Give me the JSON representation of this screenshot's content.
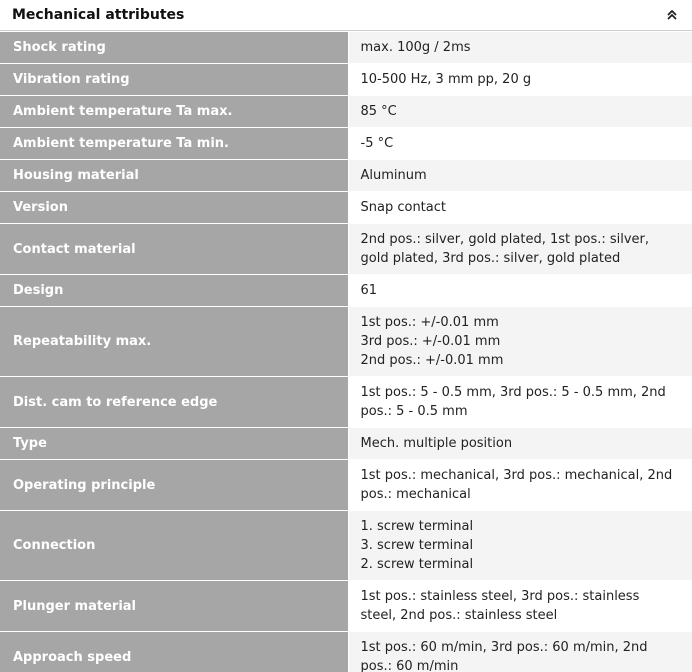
{
  "header": {
    "title": "Mechanical attributes"
  },
  "icons": {
    "collapse": "double-chevron-up-icon"
  },
  "rows": [
    {
      "label": "Shock rating",
      "lines": [
        "max. 100g / 2ms"
      ]
    },
    {
      "label": "Vibration rating",
      "lines": [
        "10-500 Hz, 3 mm pp, 20 g"
      ]
    },
    {
      "label": "Ambient temperature Ta max.",
      "lines": [
        "85 °C"
      ]
    },
    {
      "label": "Ambient temperature Ta min.",
      "lines": [
        "-5 °C"
      ]
    },
    {
      "label": "Housing material",
      "lines": [
        "Aluminum"
      ]
    },
    {
      "label": "Version",
      "lines": [
        "Snap contact"
      ]
    },
    {
      "label": "Contact material",
      "lines": [
        "2nd pos.: silver, gold plated, 1st pos.: silver,",
        "gold plated, 3rd pos.: silver, gold plated"
      ]
    },
    {
      "label": "Design",
      "lines": [
        "61"
      ]
    },
    {
      "label": "Repeatability max.",
      "lines": [
        "1st pos.: +/-0.01 mm",
        "3rd pos.: +/-0.01 mm",
        "2nd pos.: +/-0.01 mm"
      ]
    },
    {
      "label": "Dist. cam to reference edge",
      "lines": [
        "1st pos.: 5 - 0.5 mm, 3rd pos.: 5 - 0.5 mm, 2nd",
        "pos.: 5 - 0.5 mm"
      ]
    },
    {
      "label": "Type",
      "lines": [
        "Mech. multiple position"
      ]
    },
    {
      "label": "Operating principle",
      "lines": [
        "1st pos.: mechanical, 3rd pos.: mechanical, 2nd",
        "pos.: mechanical"
      ]
    },
    {
      "label": "Connection",
      "lines": [
        "1. screw terminal",
        "3. screw terminal",
        "2. screw terminal"
      ]
    },
    {
      "label": "Plunger material",
      "lines": [
        "1st pos.: stainless steel, 3rd pos.: stainless",
        "steel, 2nd pos.: stainless steel"
      ]
    },
    {
      "label": "Approach speed",
      "lines": [
        "1st pos.: 60 m/min, 3rd pos.: 60 m/min, 2nd",
        "pos.: 60 m/min"
      ]
    }
  ]
}
